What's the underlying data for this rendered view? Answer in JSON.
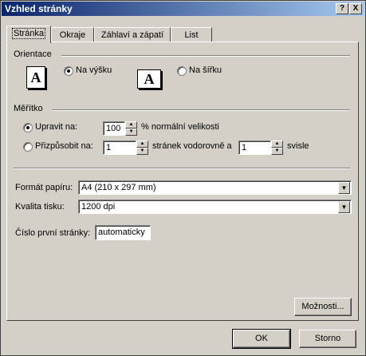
{
  "window": {
    "title": "Vzhled stránky",
    "help_label": "?",
    "close_label": "X"
  },
  "tabs": [
    {
      "label": "Stránka",
      "active": true
    },
    {
      "label": "Okraje",
      "active": false
    },
    {
      "label": "Záhlaví a zápatí",
      "active": false
    },
    {
      "label": "List",
      "active": false
    }
  ],
  "orientation": {
    "heading": "Orientace",
    "portrait_label": "Na výšku",
    "landscape_label": "Na šířku",
    "portrait_icon_glyph": "A",
    "landscape_icon_glyph": "A",
    "selected": "portrait"
  },
  "scaling": {
    "heading": "Měřítko",
    "adjust_label": "Upravit na:",
    "adjust_value": "100",
    "adjust_suffix": "% normální velikosti",
    "fit_label": "Přizpůsobit na:",
    "fit_wide_value": "1",
    "fit_mid_label": "stránek vodorovně a",
    "fit_tall_value": "1",
    "fit_suffix": "svisle",
    "selected": "adjust"
  },
  "paper": {
    "paper_size_label": "Formát papíru:",
    "paper_size_value": "A4 (210 x 297 mm)",
    "print_quality_label": "Kvalita tisku:",
    "print_quality_value": "1200 dpi",
    "first_page_label": "Číslo první stránky:",
    "first_page_value": "automaticky"
  },
  "buttons": {
    "options_label": "Možnosti...",
    "ok_label": "OK",
    "cancel_label": "Storno"
  },
  "icons": {
    "dropdown": "triangle-down",
    "spin_up": "triangle-up",
    "spin_down": "triangle-down"
  }
}
